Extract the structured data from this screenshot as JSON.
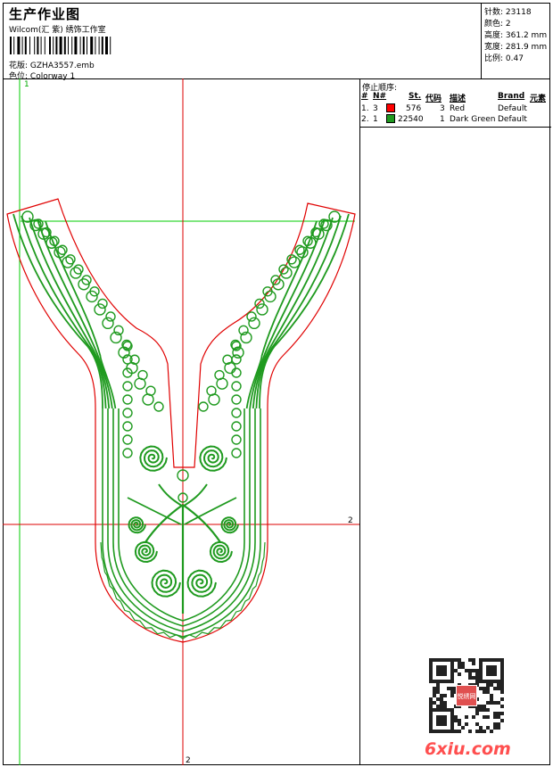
{
  "header": {
    "title": "生产作业图",
    "company": "Wilcom(汇 紫) 绣饰工作室",
    "file_label": "花版:",
    "file_name": "GZHA3557.emb",
    "colorway_label": "色位:",
    "colorway_name": "Colorway 1"
  },
  "stats": [
    {
      "label": "针数:",
      "value": "23118"
    },
    {
      "label": "颜色:",
      "value": "2"
    },
    {
      "label": "高度:",
      "value": "361.2 mm"
    },
    {
      "label": "宽度:",
      "value": "281.9 mm"
    },
    {
      "label": "比例:",
      "value": "0.47"
    }
  ],
  "stop_sequence": {
    "title": "停止顺序:",
    "headers": [
      "#",
      "N#",
      "St.",
      "代码",
      "描述",
      "Brand",
      "元素"
    ],
    "rows": [
      {
        "index": "1.",
        "n": "3",
        "color": "#ff0000",
        "stitches": "576",
        "code": "3",
        "description": "Red",
        "brand": "Default"
      },
      {
        "index": "2.",
        "n": "1",
        "color": "#1f9a1f",
        "stitches": "22540",
        "code": "1",
        "description": "Dark Green",
        "brand": "Default"
      }
    ]
  },
  "guides": {
    "vertical_1": "1",
    "horizontal_2": "2",
    "vertical_2": "2"
  },
  "colors": {
    "embroidery": "#1f9a1f",
    "outline": "#e00000",
    "guide_green": "#00cc00",
    "guide_red": "#dd0000"
  },
  "watermark": "6xiu.com",
  "qr_badge": "悦绣网"
}
